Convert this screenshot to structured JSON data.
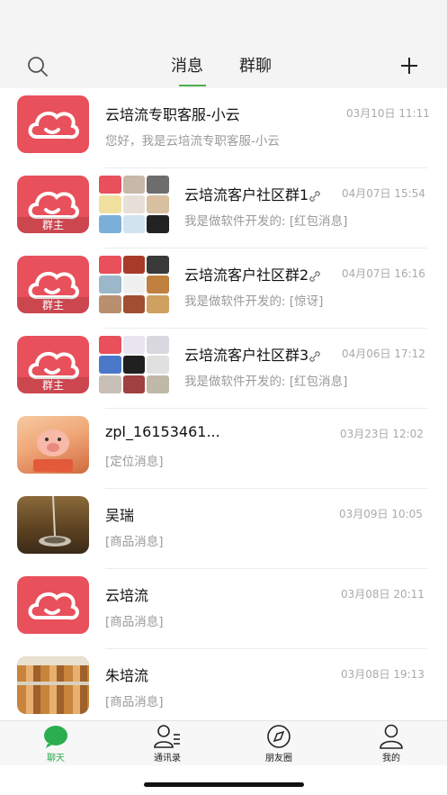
{
  "header": {
    "tabs": [
      {
        "label": "消息",
        "active": true
      },
      {
        "label": "群聊",
        "active": false
      }
    ],
    "search_icon": "search-icon",
    "add_icon": "plus-icon",
    "accent": "#4caf50"
  },
  "conversations": [
    {
      "name": "云培流专职客服-小云",
      "time": "03月10日 11:11",
      "preview": "您好，我是云培流专职客服-小云",
      "avatar": "cloud-logo",
      "group": false
    },
    {
      "name": "云培流客户社区群1",
      "time": "04月07日 15:54",
      "preview": "我是做软件开发的: [红包消息]",
      "avatar": "cloud-logo",
      "group": true,
      "owner_tag": "群主"
    },
    {
      "name": "云培流客户社区群2",
      "time": "04月07日 16:16",
      "preview": "我是做软件开发的: [惊讶]",
      "avatar": "cloud-logo",
      "group": true,
      "owner_tag": "群主"
    },
    {
      "name": "云培流客户社区群3",
      "time": "04月06日 17:12",
      "preview": "我是做软件开发的: [红包消息]",
      "avatar": "cloud-logo",
      "group": true,
      "owner_tag": "群主"
    },
    {
      "name": "zpl_16153461...",
      "time": "03月23日 12:02",
      "preview": "[定位消息]",
      "avatar": "pig-photo",
      "group": false
    },
    {
      "name": "吴瑞",
      "time": "03月09日 10:05",
      "preview": "[商品消息]",
      "avatar": "spoon-photo",
      "group": false
    },
    {
      "name": "云培流",
      "time": "03月08日 20:11",
      "preview": "[商品消息]",
      "avatar": "cloud-logo",
      "group": false
    },
    {
      "name": "朱培流",
      "time": "03月08日 19:13",
      "preview": "[商品消息]",
      "avatar": "bakery-photo",
      "group": false
    }
  ],
  "tabbar": {
    "items": [
      {
        "label": "聊天",
        "icon": "chat-bubble-icon",
        "active": true
      },
      {
        "label": "通讯录",
        "icon": "contacts-icon",
        "active": false
      },
      {
        "label": "朋友圈",
        "icon": "compass-icon",
        "active": false
      },
      {
        "label": "我的",
        "icon": "person-icon",
        "active": false
      }
    ],
    "active_color": "#2aae4f"
  },
  "colors": {
    "brand_red": "#e8505b"
  }
}
